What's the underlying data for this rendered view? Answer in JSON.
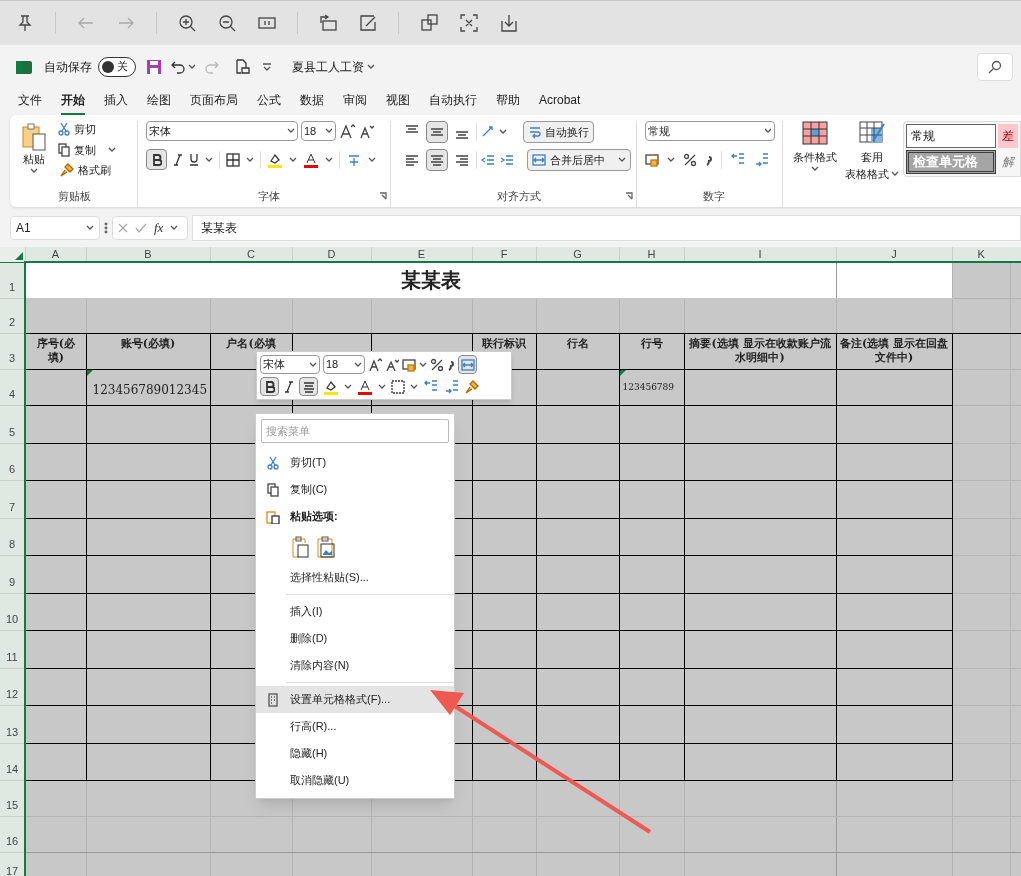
{
  "title_bar": {
    "autosave_label": "自动保存",
    "autosave": {
      "on": false,
      "label": "关"
    },
    "filename": "夏县工人工资"
  },
  "tabs": [
    {
      "label": "文件",
      "selected": false
    },
    {
      "label": "开始",
      "selected": true
    },
    {
      "label": "插入",
      "selected": false
    },
    {
      "label": "绘图",
      "selected": false
    },
    {
      "label": "页面布局",
      "selected": false
    },
    {
      "label": "公式",
      "selected": false
    },
    {
      "label": "数据",
      "selected": false
    },
    {
      "label": "审阅",
      "selected": false
    },
    {
      "label": "视图",
      "selected": false
    },
    {
      "label": "自动执行",
      "selected": false
    },
    {
      "label": "帮助",
      "selected": false
    },
    {
      "label": "Acrobat",
      "selected": false
    }
  ],
  "ribbon": {
    "clipboard": {
      "title": "剪贴板",
      "paste": "粘贴",
      "cut": "剪切",
      "copy": "复制",
      "format_painter": "格式刷"
    },
    "font": {
      "title": "字体",
      "font_name": "宋体",
      "font_size": "18",
      "bold": true
    },
    "alignment": {
      "title": "对齐方式",
      "align_middle": true,
      "align_center": true,
      "wrap_text": "自动换行",
      "merge_center": "合并后居中"
    },
    "number": {
      "title": "数字",
      "format": "常规"
    },
    "styles": {
      "conditional_format": "条件格式",
      "table_format_1": "套用",
      "table_format_2": "表格格式",
      "cell_styles": [
        {
          "kind": "normal",
          "label": "常规"
        },
        {
          "kind": "bad",
          "label": "差"
        },
        {
          "kind": "check",
          "label": "检查单元格"
        },
        {
          "kind": "explain",
          "label": "解"
        }
      ]
    }
  },
  "formula_bar": {
    "name_box": "A1",
    "function_label": "fx",
    "formula": "某某表"
  },
  "sheet": {
    "columns": [
      "A",
      "B",
      "C",
      "D",
      "E",
      "F",
      "G",
      "H",
      "I",
      "J",
      "K"
    ],
    "rows": [
      "1",
      "2",
      "3",
      "4",
      "5",
      "6",
      "7",
      "8",
      "9",
      "10",
      "11",
      "12",
      "13",
      "14",
      "15",
      "16",
      "17"
    ],
    "title": "某某表",
    "headers": {
      "A": "序号(必填)",
      "B": "账号(必填)",
      "C": "户名(必填",
      "F": "联行标识",
      "G": "行名",
      "H": "行号",
      "I": "摘要(选填 显示在收款账户流水明细中)",
      "J": "备注(选填 显示在回盘文件中)"
    },
    "row4": {
      "B": "123456789012345",
      "H": "123456789"
    }
  },
  "mini_toolbar": {
    "font_name": "宋体",
    "font_size": "18",
    "bold": true,
    "align_center": true,
    "merge_center": true
  },
  "context_menu": {
    "search_placeholder": "搜索菜单",
    "items": [
      {
        "kind": "cut",
        "label": "剪切(T)",
        "selected": false
      },
      {
        "kind": "copy",
        "label": "复制(C)",
        "selected": false
      },
      {
        "kind": "paste_heading",
        "label": "粘贴选项:",
        "selected": false
      },
      {
        "kind": "paste_options",
        "selected": false
      },
      {
        "kind": "command",
        "label": "选择性粘贴(S)...",
        "selected": false
      },
      {
        "kind": "separator"
      },
      {
        "kind": "command",
        "label": "插入(I)",
        "selected": false
      },
      {
        "kind": "command",
        "label": "删除(D)",
        "selected": false
      },
      {
        "kind": "command",
        "label": "清除内容(N)",
        "selected": false
      },
      {
        "kind": "separator"
      },
      {
        "kind": "format_cells",
        "label": "设置单元格格式(F)...",
        "selected": true
      },
      {
        "kind": "command",
        "label": "行高(R)...",
        "selected": false
      },
      {
        "kind": "command",
        "label": "隐藏(H)",
        "selected": false
      },
      {
        "kind": "command",
        "label": "取消隐藏(U)",
        "selected": false
      }
    ]
  }
}
